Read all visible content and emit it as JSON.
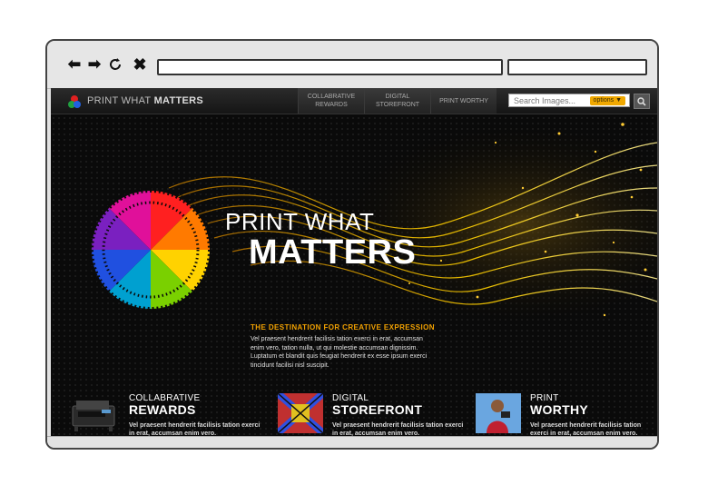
{
  "browser": {
    "back_icon": "arrow-left-icon",
    "forward_icon": "arrow-right-icon",
    "reload_icon": "reload-icon",
    "close_icon": "close-icon",
    "address_value": "",
    "search_value": ""
  },
  "site": {
    "brand_light": "PRINT WHAT ",
    "brand_bold": "MATTERS",
    "nav": [
      {
        "line1": "COLLABRATIVE",
        "line2": "REWARDS"
      },
      {
        "line1": "DIGITAL",
        "line2": "STOREFRONT"
      },
      {
        "line1": "PRINT WORTHY",
        "line2": ""
      }
    ],
    "search_placeholder": "Search Images...",
    "search_options": "options",
    "accent": "#f0a800"
  },
  "hero": {
    "title_line1": "PRINT WHAT",
    "title_line2": "MATTERS",
    "tagline": "THE DESTINATION FOR CREATIVE EXPRESSION",
    "body": "Vel praesent hendrerit facilisis tation exerci in erat, accumsan enim vero, tation nulla, ut qui molestie accumsan dignissim. Luptatum et blandit quis feugiat hendrerit ex esse ipsum exerci tincidunt facilisi nisl suscipit."
  },
  "features": [
    {
      "line1": "COLLABRATIVE",
      "line2": "REWARDS",
      "desc": "Vel praesent hendrerit facilisis tation exerci in erat, accumsan enim vero."
    },
    {
      "line1": "DIGITAL",
      "line2": "STOREFRONT",
      "desc": "Vel praesent hendrerit facilisis tation exerci in erat, accumsan enim vero."
    },
    {
      "line1": "PRINT",
      "line2": "WORTHY",
      "desc": "Vel praesent hendrerit facilisis tation exerci in erat, accumsan enim vero."
    }
  ]
}
